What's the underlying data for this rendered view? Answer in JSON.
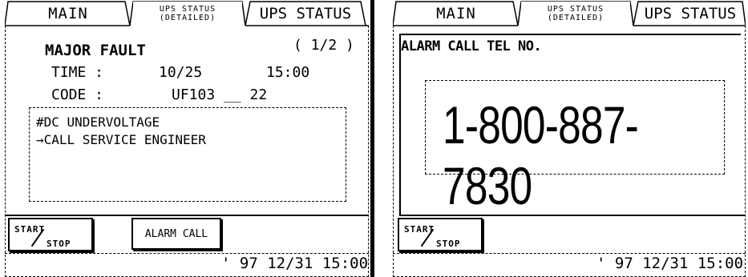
{
  "left": {
    "tabs": {
      "main": "MAIN",
      "detail_top": "UPS STATUS",
      "detail_bottom": "(DETAILED)",
      "status": "UPS STATUS"
    },
    "title": "MAJOR FAULT",
    "page": "( 1/2 )",
    "time_label": "TIME  :",
    "time_date": "10/25",
    "time_clock": "15:00",
    "code_label": "CODE  :",
    "code_value": "UF103 __ 22",
    "messages": [
      "#DC UNDERVOLTAGE",
      "→CALL SERVICE ENGINEER"
    ],
    "start_top": "START",
    "start_bottom": "STOP",
    "alarm_call": "ALARM CALL",
    "clock": "' 97 12/31 15:00"
  },
  "right": {
    "tabs": {
      "main": "MAIN",
      "detail_top": "UPS STATUS",
      "detail_bottom": "(DETAILED)",
      "status": "UPS STATUS"
    },
    "heading": "ALARM CALL TEL NO.",
    "phone": "1-800-887-7830",
    "start_top": "START",
    "start_bottom": "STOP",
    "clock": "' 97 12/31 15:00"
  }
}
